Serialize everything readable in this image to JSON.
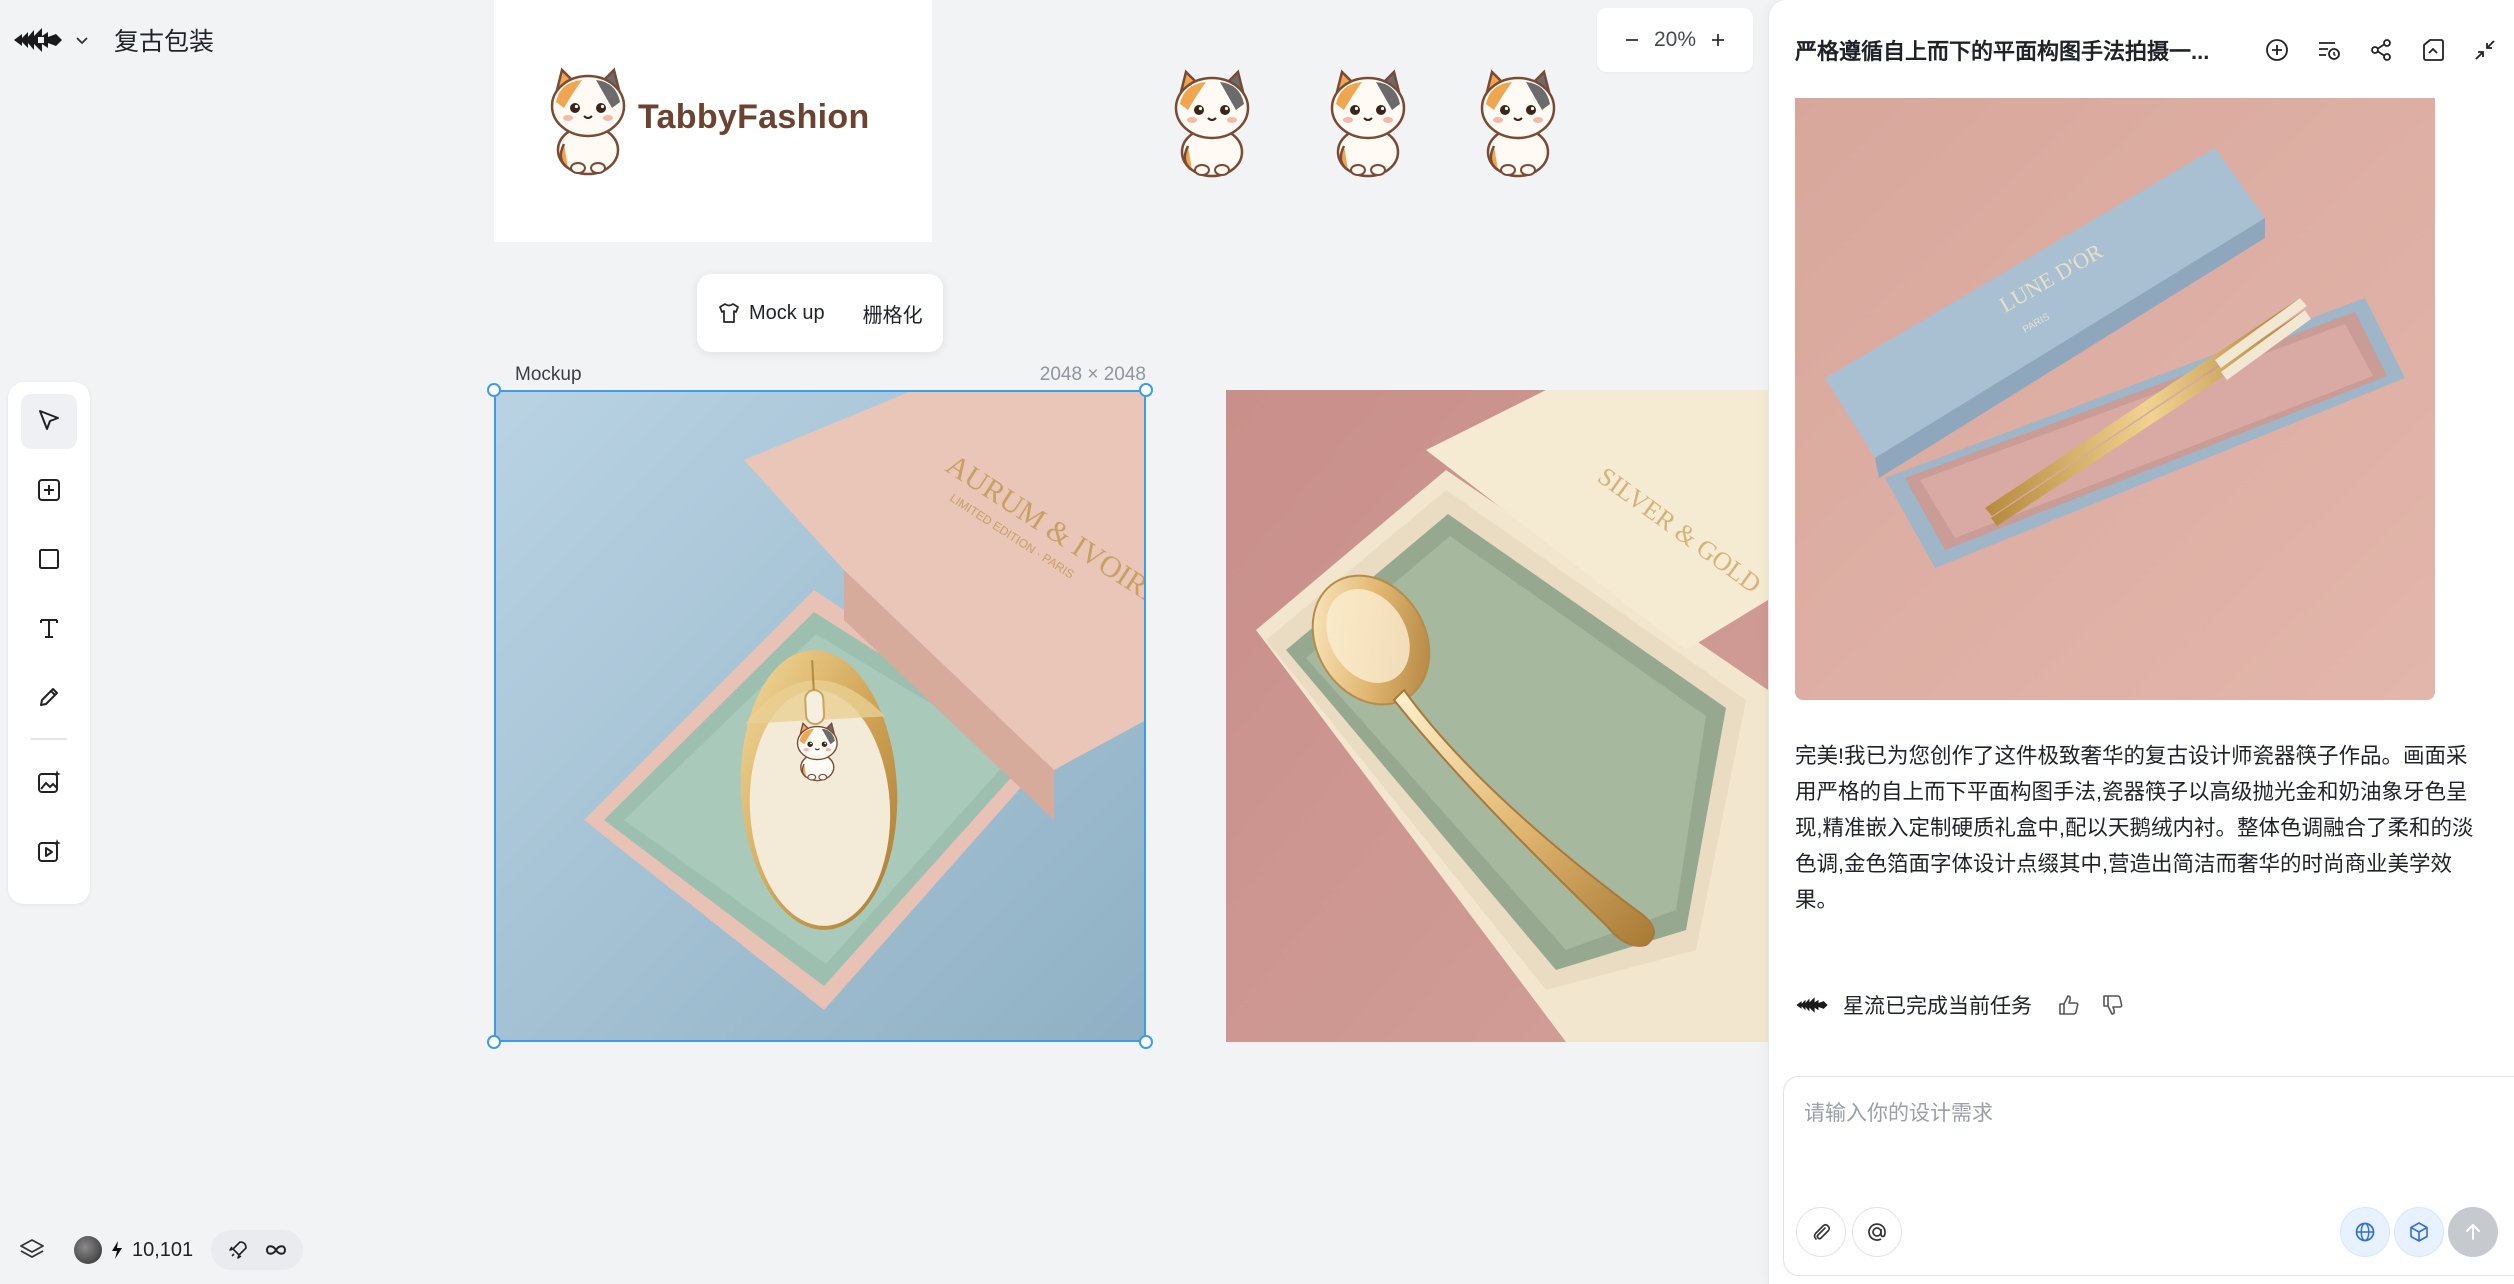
{
  "app": {
    "project_title": "复古包装"
  },
  "zoom": {
    "level": "20%"
  },
  "canvas": {
    "logo_wordmark": "TabbyFashion",
    "context_menu": {
      "mockup_label": "Mock up",
      "rasterize_label": "栅格化"
    },
    "selected_frame": {
      "label": "Mockup",
      "size": "2048 × 2048"
    },
    "mockup_box_text": "AURUM & IVOIRE",
    "mockup_box_subtext": "LIMITED EDITION · PARIS",
    "second_box_text": "SILVER & GOLD"
  },
  "bottom": {
    "credits": "10,101"
  },
  "panel": {
    "title": "严格遵循自上而下的平面构图手法拍摄一...",
    "image_box_text": "LUNE D'OR",
    "image_box_subtext": "PARIS",
    "message": "完美!我已为您创作了这件极致奢华的复古设计师瓷器筷子作品。画面采用严格的自上而下平面构图手法,瓷器筷子以高级抛光金和奶油象牙色呈现,精准嵌入定制硬质礼盒中,配以天鹅绒内衬。整体色调融合了柔和的淡色调,金色箔面字体设计点缀其中,营造出简洁而奢华的时尚商业美学效果。",
    "status": "星流已完成当前任务",
    "input_placeholder": "请输入你的设计需求"
  },
  "colors": {
    "selection": "#3b9cf0",
    "canvas_bg": "#f2f3f5"
  }
}
